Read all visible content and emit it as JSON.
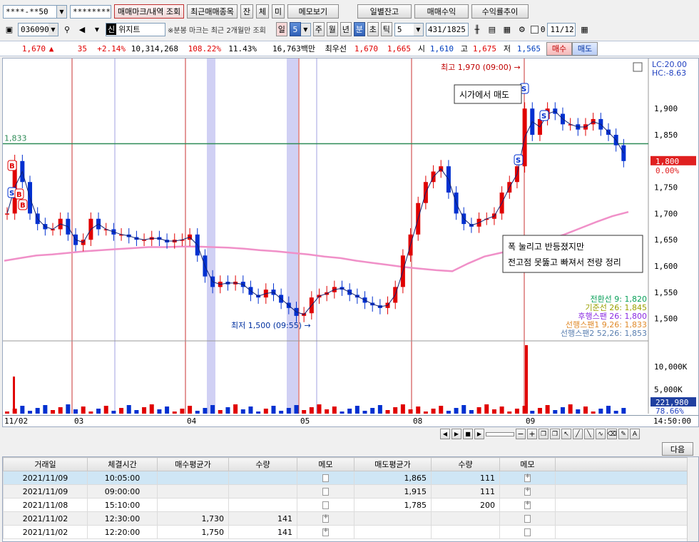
{
  "toolbar1": {
    "account": "****-**50",
    "password": "*********",
    "btn_trade_marks": "매매마크/내역 조회",
    "btn_recent": "최근매매종목",
    "btn_jan": "잔",
    "btn_che": "체",
    "btn_mi": "미",
    "btn_memo": "메모보기",
    "btn_daily": "일별잔고",
    "btn_profit": "매매수익",
    "btn_return": "수익률추이"
  },
  "toolbar2": {
    "code": "036090",
    "stock_name": "위지트",
    "prefix_label": "신",
    "note": "※분봉 마크는 최근 2개월만 조회",
    "periods": [
      "일",
      "5",
      "주",
      "월",
      "년",
      "분",
      "초",
      "틱"
    ],
    "period_selected": "분",
    "interval": "5",
    "count": "431/1825",
    "check_label": "0",
    "date": "11/12"
  },
  "quote": {
    "price": "1,670",
    "arrow": "▲",
    "change": "35",
    "change_pct": "+2.14%",
    "volume": "10,314,268",
    "vol_ratio": "108.22%",
    "turnover": "11.43%",
    "amount": "16,763백만",
    "bid_label": "최우선",
    "bid1": "1,670",
    "bid2": "1,665",
    "open_label": "시",
    "open": "1,610",
    "high_label": "고",
    "high": "1,675",
    "low_label": "저",
    "low": "1,565",
    "buy_btn": "매수",
    "sell_btn": "매도"
  },
  "chart_data": {
    "type": "candlestick",
    "title": "",
    "xlabel": "",
    "ylabel": "",
    "ylim": [
      1460,
      1990
    ],
    "y_ticks": [
      "1,900",
      "1,850",
      "1,800",
      "1,750",
      "1,700",
      "1,650",
      "1,600",
      "1,550",
      "1,500"
    ],
    "y_tick_values": [
      1900,
      1850,
      1800,
      1750,
      1700,
      1650,
      1600,
      1550,
      1500
    ],
    "x_ticks": [
      "11/02",
      "03",
      "04",
      "05",
      "08",
      "09",
      "14:50:00"
    ],
    "reference_line": {
      "value": 1833,
      "label": "1,833",
      "color": "#2e8b57"
    },
    "current_price": {
      "value": 1800,
      "label": "1,800",
      "pct": "0.00%",
      "color": "#e02020"
    },
    "top_right_labels": [
      "LC:20.00",
      "HC:-8.63"
    ],
    "high_annotation": {
      "label": "최고 1,970 (09:00)",
      "value": 1970
    },
    "low_annotation": {
      "label": "최저 1,500 (09:55)",
      "value": 1500
    },
    "memo_boxes": [
      "시가에서 매도",
      "폭 눌리고 반등졌지만",
      "전고점 못뚫고 빠져서 전량 정리"
    ],
    "ichimoku_legend": [
      {
        "label": "전환선 9: 1,820",
        "color": "#0aa05a"
      },
      {
        "label": "기준선 26: 1,845",
        "color": "#9aa000"
      },
      {
        "label": "후행스팬 26: 1,800",
        "color": "#8a2be2"
      },
      {
        "label": "선행스팬1 9,26: 1,833",
        "color": "#e08a2a"
      },
      {
        "label": "선행스팬2 52,26: 1,853",
        "color": "#5a7fb0"
      }
    ],
    "close_series": [
      1700,
      1800,
      1760,
      1700,
      1680,
      1670,
      1670,
      1690,
      1660,
      1640,
      1650,
      1690,
      1670,
      1670,
      1660,
      1660,
      1655,
      1650,
      1650,
      1655,
      1650,
      1645,
      1650,
      1650,
      1660,
      1620,
      1580,
      1560,
      1570,
      1565,
      1570,
      1560,
      1545,
      1540,
      1555,
      1545,
      1530,
      1520,
      1505,
      1510,
      1540,
      1545,
      1550,
      1560,
      1555,
      1545,
      1540,
      1530,
      1525,
      1520,
      1530,
      1560,
      1620,
      1660,
      1720,
      1760,
      1780,
      1790,
      1740,
      1700,
      1680,
      1675,
      1690,
      1690,
      1700,
      1740,
      1760,
      1790,
      1900,
      1850,
      1880,
      1900,
      1890,
      1870,
      1870,
      1860,
      1870,
      1880,
      1860,
      1850,
      1830,
      1800
    ],
    "ma_series": [
      1610,
      1615,
      1620,
      1622,
      1625,
      1628,
      1630,
      1632,
      1634,
      1636,
      1636,
      1637,
      1637,
      1636,
      1635,
      1633,
      1630,
      1628,
      1625,
      1622,
      1618,
      1615,
      1610,
      1606,
      1602,
      1598,
      1595,
      1592,
      1590,
      1605,
      1618,
      1625,
      1632,
      1640,
      1650,
      1660,
      1672,
      1684,
      1695,
      1703
    ],
    "volume": {
      "y_ticks": [
        "10,000K",
        "5,000K"
      ],
      "current_label": "221,980",
      "pct_label": "78.66%"
    }
  },
  "trade_markers": [
    {
      "type": "B"
    },
    {
      "type": "S"
    },
    {
      "type": "B"
    },
    {
      "type": "B"
    },
    {
      "type": "S"
    },
    {
      "type": "S"
    },
    {
      "type": "S"
    }
  ],
  "nav": {
    "next_btn": "다음"
  },
  "table": {
    "headers": [
      "거래일",
      "체결시간",
      "매수평균가",
      "수량",
      "메모",
      "매도평균가",
      "수량",
      "메모"
    ],
    "rows": [
      {
        "date": "2021/11/09",
        "time": "10:05:00",
        "buy_avg": "",
        "buy_qty": "",
        "sell_avg": "1,865",
        "sell_qty": "111"
      },
      {
        "date": "2021/11/09",
        "time": "09:00:00",
        "buy_avg": "",
        "buy_qty": "",
        "sell_avg": "1,915",
        "sell_qty": "111"
      },
      {
        "date": "2021/11/08",
        "time": "15:10:00",
        "buy_avg": "",
        "buy_qty": "",
        "sell_avg": "1,785",
        "sell_qty": "200"
      },
      {
        "date": "2021/11/02",
        "time": "12:30:00",
        "buy_avg": "1,730",
        "buy_qty": "141",
        "sell_avg": "",
        "sell_qty": ""
      },
      {
        "date": "2021/11/02",
        "time": "12:20:00",
        "buy_avg": "1,750",
        "buy_qty": "141",
        "sell_avg": "",
        "sell_qty": ""
      }
    ]
  }
}
